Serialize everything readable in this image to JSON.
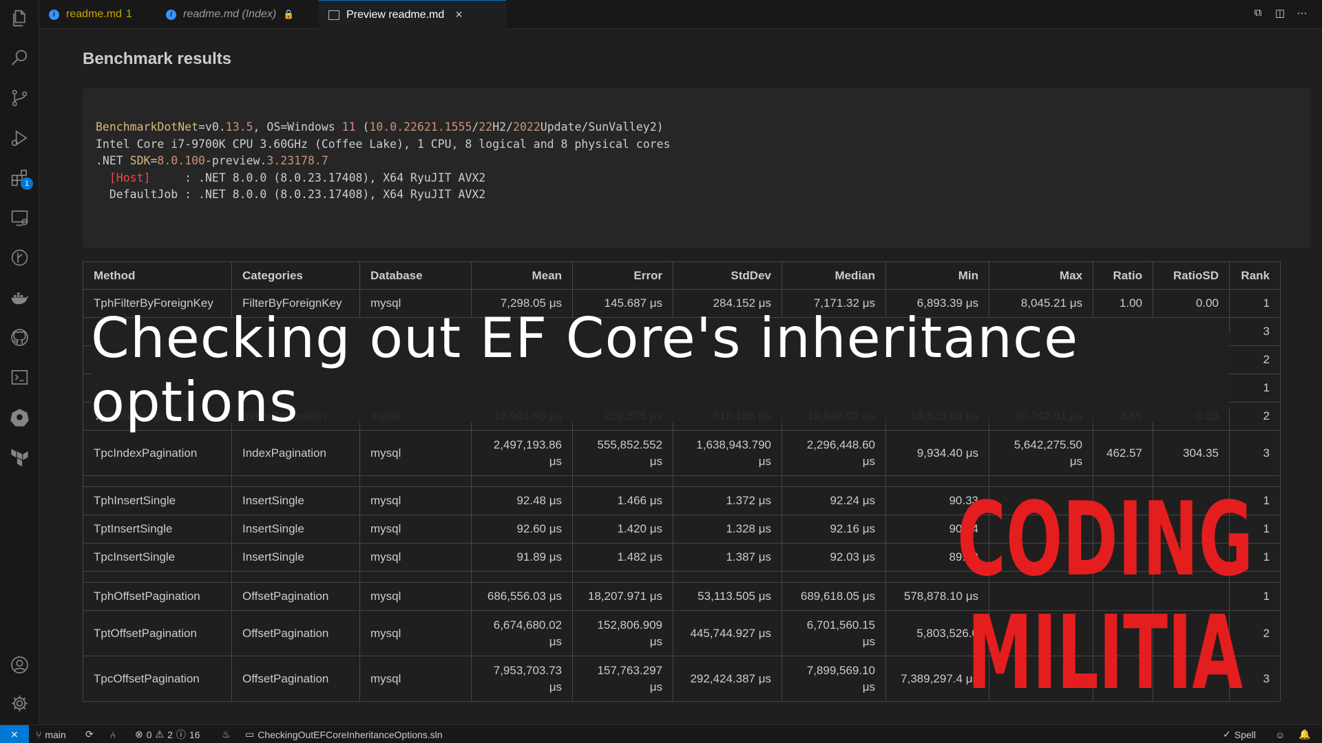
{
  "tabs": [
    {
      "label": "readme.md",
      "badge": "1"
    },
    {
      "label": "readme.md (Index)"
    },
    {
      "label": "Preview readme.md",
      "close": "×"
    }
  ],
  "activity_bar": {
    "icons": [
      "explorer-icon",
      "search-icon",
      "source-control-icon",
      "run-debug-icon",
      "extensions-icon",
      "remote-explorer-icon",
      "git-graph-icon",
      "docker-icon",
      "github-icon",
      "terminal-icon",
      "kubernetes-icon",
      "terraform-icon",
      "account-icon",
      "settings-icon"
    ],
    "extensions_badge": "1"
  },
  "doc": {
    "heading": "Benchmark results",
    "code": {
      "l1a": "BenchmarkDotNet",
      "l1b": "=v0.",
      "l1c": "13.5",
      "l1d": ", OS=Windows ",
      "l1e": "11",
      "l1f": " (",
      "l1g": "10.0.22621.1555",
      "l1h": "/",
      "l1i": "22",
      "l1j": "H2/",
      "l1k": "2022",
      "l1l": "Update/SunValley2)",
      "l2": "Intel Core i7-9700K CPU 3.60GHz (Coffee Lake), 1 CPU, 8 logical and 8 physical cores",
      "l3a": ".NET ",
      "l3b": "SDK",
      "l3c": "=",
      "l3d": "8.0.100",
      "l3e": "-preview.",
      "l3f": "3.23178.7",
      "l4a": "  ",
      "l4b": "[Host]",
      "l4c": "     : .NET 8.0.0 (8.0.23.17408), X64 RyuJIT AVX2",
      "l5": "  DefaultJob : .NET 8.0.0 (8.0.23.17408), X64 RyuJIT AVX2"
    }
  },
  "table": {
    "headers": [
      "Method",
      "Categories",
      "Database",
      "Mean",
      "Error",
      "StdDev",
      "Median",
      "Min",
      "Max",
      "Ratio",
      "RatioSD",
      "Rank"
    ],
    "rows": [
      [
        "TphFilterByForeignKey",
        "FilterByForeignKey",
        "mysql",
        "7,298.05 μs",
        "145.687 μs",
        "284.152 μs",
        "7,171.32 μs",
        "6,893.39 μs",
        "8,045.21 μs",
        "1.00",
        "0.00",
        "1"
      ],
      [
        "",
        "",
        "",
        "",
        "",
        "",
        "",
        "",
        "",
        "",
        "",
        "3"
      ],
      [
        "",
        "",
        "",
        "",
        "",
        "",
        "",
        "",
        "",
        "",
        "",
        "2"
      ],
      [
        "",
        "",
        "",
        "",
        "",
        "",
        "",
        "",
        "",
        "",
        "",
        "1"
      ],
      [
        "TptIndexPagination",
        "IndexPagination",
        "mysql",
        "19,901.95 μs",
        "252.575 μs",
        "310.185 μs",
        "19,848.02 μs",
        "19,523.03 μs",
        "20,742.01 μs",
        "3.65",
        "0.23",
        "2"
      ],
      [
        "TpcIndexPagination",
        "IndexPagination",
        "mysql",
        "2,497,193.86 μs",
        "555,852.552 μs",
        "1,638,943.790 μs",
        "2,296,448.60 μs",
        "9,934.40 μs",
        "5,642,275.50 μs",
        "462.57",
        "304.35",
        "3"
      ],
      [
        "TphInsertSingle",
        "InsertSingle",
        "mysql",
        "92.48 μs",
        "1.466 μs",
        "1.372 μs",
        "92.24 μs",
        "90.33",
        "",
        "",
        "",
        "1"
      ],
      [
        "TptInsertSingle",
        "InsertSingle",
        "mysql",
        "92.60 μs",
        "1.420 μs",
        "1.328 μs",
        "92.16 μs",
        "90.34",
        "",
        "",
        "",
        "1"
      ],
      [
        "TpcInsertSingle",
        "InsertSingle",
        "mysql",
        "91.89 μs",
        "1.482 μs",
        "1.387 μs",
        "92.03 μs",
        "89.09",
        "",
        "",
        "",
        "1"
      ],
      [
        "TphOffsetPagination",
        "OffsetPagination",
        "mysql",
        "686,556.03 μs",
        "18,207.971 μs",
        "53,113.505 μs",
        "689,618.05 μs",
        "578,878.10 μs",
        "",
        "",
        "",
        "1"
      ],
      [
        "TptOffsetPagination",
        "OffsetPagination",
        "mysql",
        "6,674,680.02 μs",
        "152,806.909 μs",
        "445,744.927 μs",
        "6,701,560.15 μs",
        "5,803,526.0",
        "",
        "",
        "",
        "2"
      ],
      [
        "TpcOffsetPagination",
        "OffsetPagination",
        "mysql",
        "7,953,703.73 μs",
        "157,763.297 μs",
        "292,424.387 μs",
        "7,899,569.10 μs",
        "7,389,297.4 μs",
        "",
        "",
        "",
        "3"
      ]
    ]
  },
  "overlay": {
    "title": "Checking out EF Core's inheritance options",
    "logo_line1": "CODING",
    "logo_line2": "MILITIA",
    "logo_color": "#e41e1e"
  },
  "status": {
    "branch": "main",
    "errors": "0",
    "warnings": "2",
    "info": "16",
    "solution": "CheckingOutEFCoreInheritanceOptions.sln",
    "spell": "Spell"
  }
}
